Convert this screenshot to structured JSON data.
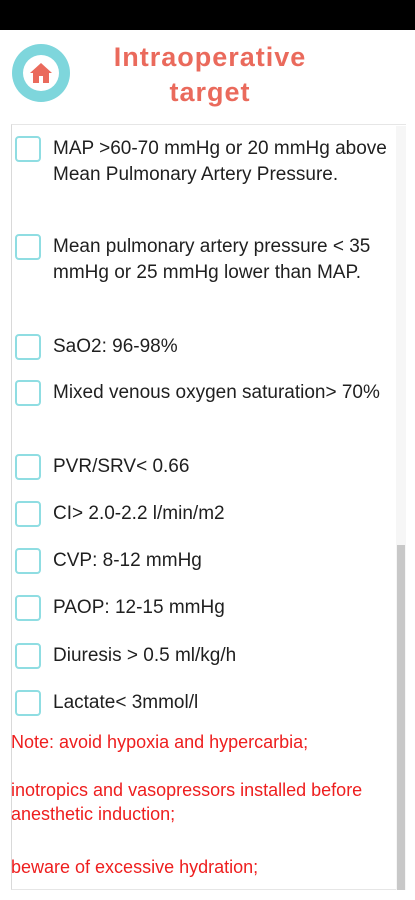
{
  "header": {
    "title": "Intraoperative target",
    "home_icon": "home-icon",
    "accent_color": "#ea6a5c",
    "home_button_color": "#7ed6dc"
  },
  "checklist": {
    "checkbox_color": "#8fdde2",
    "items": [
      {
        "label": "MAP >60-70 mmHg or 20 mmHg above Mean Pulmonary Artery Pressure.",
        "checked": false
      },
      {
        "label": "Mean pulmonary artery pressure < 35 mmHg or 25 mmHg lower than MAP.",
        "checked": false
      },
      {
        "label": "SaO2: 96-98%",
        "checked": false
      },
      {
        "label": "Mixed venous oxygen saturation> 70%",
        "checked": false
      },
      {
        "label": "PVR/SRV< 0.66",
        "checked": false
      },
      {
        "label": "CI> 2.0-2.2 l/min/m2",
        "checked": false
      },
      {
        "label": "CVP: 8-12 mmHg",
        "checked": false
      },
      {
        "label": "PAOP: 12-15 mmHg",
        "checked": false
      },
      {
        "label": "Diuresis > 0.5 ml/kg/h",
        "checked": false
      },
      {
        "label": "Lactate< 3mmol/l",
        "checked": false
      }
    ]
  },
  "notes": {
    "color": "#ee1e1e",
    "lines": [
      "Note: avoid hypoxia and hypercarbia;",
      "inotropics and vasopressors installed before anesthetic induction;",
      "beware of excessive hydration;"
    ]
  }
}
